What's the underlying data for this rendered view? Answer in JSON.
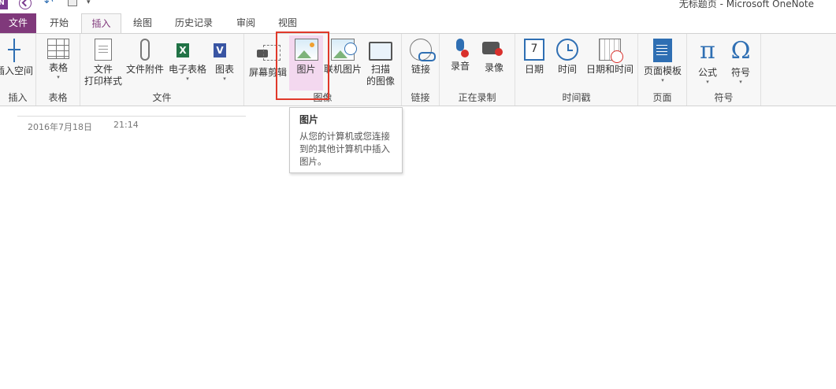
{
  "app": {
    "window_title": "无标题页 - Microsoft OneNote",
    "logo_text": "N"
  },
  "tabs": [
    {
      "label": "文件"
    },
    {
      "label": "开始"
    },
    {
      "label": "插入"
    },
    {
      "label": "绘图"
    },
    {
      "label": "历史记录"
    },
    {
      "label": "审阅"
    },
    {
      "label": "视图"
    }
  ],
  "active_tab": "插入",
  "ribbon": {
    "insert_space": {
      "label": "插入空间",
      "group": "插入"
    },
    "table": {
      "label": "表格",
      "group": "表格"
    },
    "file_group": {
      "group": "文件",
      "printout_l1": "文件",
      "printout_l2": "打印样式",
      "attachment": "文件附件",
      "spreadsheet": "电子表格",
      "diagram": "图表"
    },
    "image_group": {
      "group": "图像",
      "screen_clip": "屏幕剪辑",
      "picture": "图片",
      "online_picture": "联机图片",
      "scan_l1": "扫描",
      "scan_l2": "的图像"
    },
    "links_group": {
      "group": "链接",
      "link": "链接"
    },
    "record_group": {
      "group": "正在录制",
      "audio": "录音",
      "video": "录像"
    },
    "time_group": {
      "group": "时间戳",
      "date": "日期",
      "time": "时间",
      "date_time": "日期和时间",
      "cal_day": "7"
    },
    "pages_group": {
      "group": "页面",
      "page_template": "页面模板"
    },
    "symbols_group": {
      "group": "符号",
      "equation": "公式",
      "symbol": "符号",
      "pi": "π",
      "omega": "Ω"
    }
  },
  "tooltip": {
    "title": "图片",
    "description": "从您的计算机或您连接到的其他计算机中插入图片。"
  },
  "page": {
    "date": "2016年7月18日",
    "time": "21:14"
  },
  "icons": [
    "onenote-logo-icon",
    "back-icon",
    "undo-icon",
    "dock-icon",
    "customize-qat-icon",
    "insert-space-icon",
    "table-icon",
    "file-printout-icon",
    "attachment-icon",
    "excel-icon",
    "visio-icon",
    "screen-clipping-icon",
    "picture-icon",
    "online-picture-icon",
    "scanner-icon",
    "link-icon",
    "audio-record-icon",
    "video-record-icon",
    "calendar-icon",
    "clock-icon",
    "date-time-icon",
    "page-template-icon",
    "equation-icon",
    "symbol-icon"
  ]
}
